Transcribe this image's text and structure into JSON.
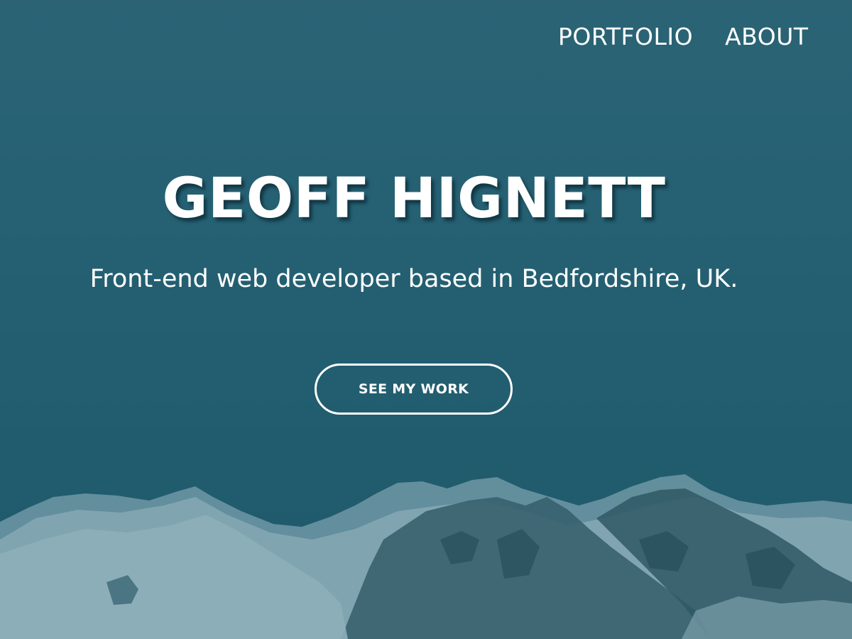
{
  "nav": {
    "items": [
      {
        "label": "PORTFOLIO"
      },
      {
        "label": "ABOUT"
      }
    ]
  },
  "hero": {
    "title": "GEOFF HIGNETT",
    "tagline": "Front-end web developer based in Bedfordshire, UK.",
    "cta_label": "SEE MY WORK",
    "background_icon": "snowy-mountain-range",
    "colors": {
      "overlay": "#256173",
      "text": "#ffffff",
      "snow": "#d9e6ea",
      "rock": "#2f4d57"
    }
  }
}
